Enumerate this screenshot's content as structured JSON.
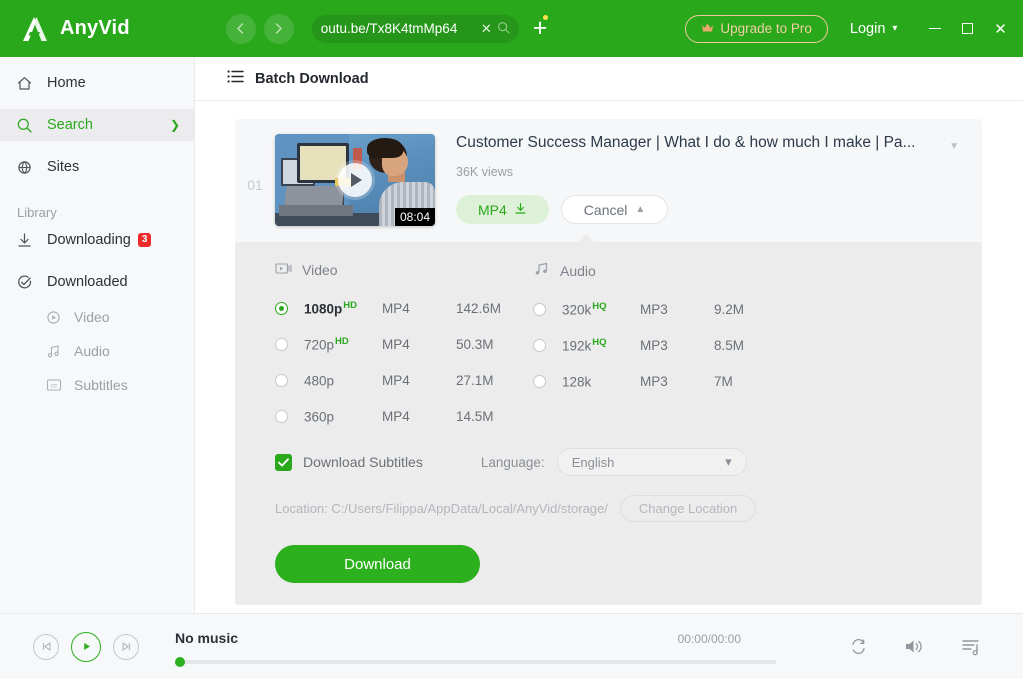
{
  "titlebar": {
    "app_name": "AnyVid",
    "logo_icon": "anyvid-logo-icon",
    "back_icon": "chevron-left-icon",
    "forward_icon": "chevron-right-icon",
    "url_value": "outu.be/Tx8K4tmMp64",
    "url_clear_icon": "close-icon",
    "url_search_icon": "search-icon",
    "new_tab_icon": "plus-icon",
    "upgrade_label": "Upgrade to Pro",
    "upgrade_icon": "crown-icon",
    "login_label": "Login",
    "login_caret_icon": "chevron-down-icon",
    "minimize_icon": "minimize-icon",
    "maximize_icon": "maximize-icon",
    "close_icon": "close-icon",
    "accent_green": "#2aa81c",
    "gold": "#f3cfa4"
  },
  "sidebar": {
    "items": [
      {
        "label": "Home",
        "icon": "home-icon"
      },
      {
        "label": "Search",
        "icon": "search-icon",
        "chevron": "chevron-right-icon"
      },
      {
        "label": "Sites",
        "icon": "globe-icon"
      }
    ],
    "library_label": "Library",
    "library_items": [
      {
        "label": "Downloading",
        "icon": "download-icon",
        "badge": "3"
      },
      {
        "label": "Downloaded",
        "icon": "check-circle-icon"
      }
    ],
    "sub_items": [
      {
        "label": "Video",
        "icon": "play-circle-icon"
      },
      {
        "label": "Audio",
        "icon": "music-note-icon"
      },
      {
        "label": "Subtitles",
        "icon": "cc-icon"
      }
    ]
  },
  "page": {
    "header_title": "Batch Download",
    "header_icon": "list-icon"
  },
  "card": {
    "index": "01",
    "thumbnail_icon": "video-thumbnail",
    "play_icon": "play-icon",
    "duration": "08:04",
    "title": "Customer Success Manager | What I do & how much I make | Pa...",
    "title_caret_icon": "chevron-down-icon",
    "views": "36K views",
    "format_button": "MP4",
    "format_button_icon": "download-icon",
    "cancel_button": "Cancel",
    "cancel_caret_icon": "chevron-up-icon"
  },
  "panel": {
    "video": {
      "header": "Video",
      "icon": "video-camera-icon",
      "rows": [
        {
          "quality": "1080p",
          "tag": "HD",
          "ext": "MP4",
          "size": "142.6M",
          "selected": true
        },
        {
          "quality": "720p",
          "tag": "HD",
          "ext": "MP4",
          "size": "50.3M",
          "selected": false
        },
        {
          "quality": "480p",
          "tag": "",
          "ext": "MP4",
          "size": "27.1M",
          "selected": false
        },
        {
          "quality": "360p",
          "tag": "",
          "ext": "MP4",
          "size": "14.5M",
          "selected": false
        }
      ]
    },
    "audio": {
      "header": "Audio",
      "icon": "music-note-icon",
      "rows": [
        {
          "quality": "320k",
          "tag": "HQ",
          "ext": "MP3",
          "size": "9.2M",
          "selected": false
        },
        {
          "quality": "192k",
          "tag": "HQ",
          "ext": "MP3",
          "size": "8.5M",
          "selected": false
        },
        {
          "quality": "128k",
          "tag": "",
          "ext": "MP3",
          "size": "7M",
          "selected": false
        }
      ]
    },
    "subtitles_label": "Download Subtitles",
    "subtitles_checked": true,
    "check_icon": "check-icon",
    "language_label": "Language:",
    "language_value": "English",
    "language_caret_icon": "chevron-down-icon",
    "location_text": "Location: C:/Users/Filippa/AppData/Local/AnyVid/storage/",
    "change_location_label": "Change Location",
    "download_label": "Download",
    "download_color": "#2cb01d"
  },
  "player": {
    "prev_icon": "skip-back-icon",
    "play_icon": "play-icon",
    "next_icon": "skip-forward-icon",
    "track_name": "No music",
    "time": "00:00/00:00",
    "repeat_icon": "repeat-icon",
    "volume_icon": "volume-icon",
    "playlist_icon": "playlist-icon"
  }
}
